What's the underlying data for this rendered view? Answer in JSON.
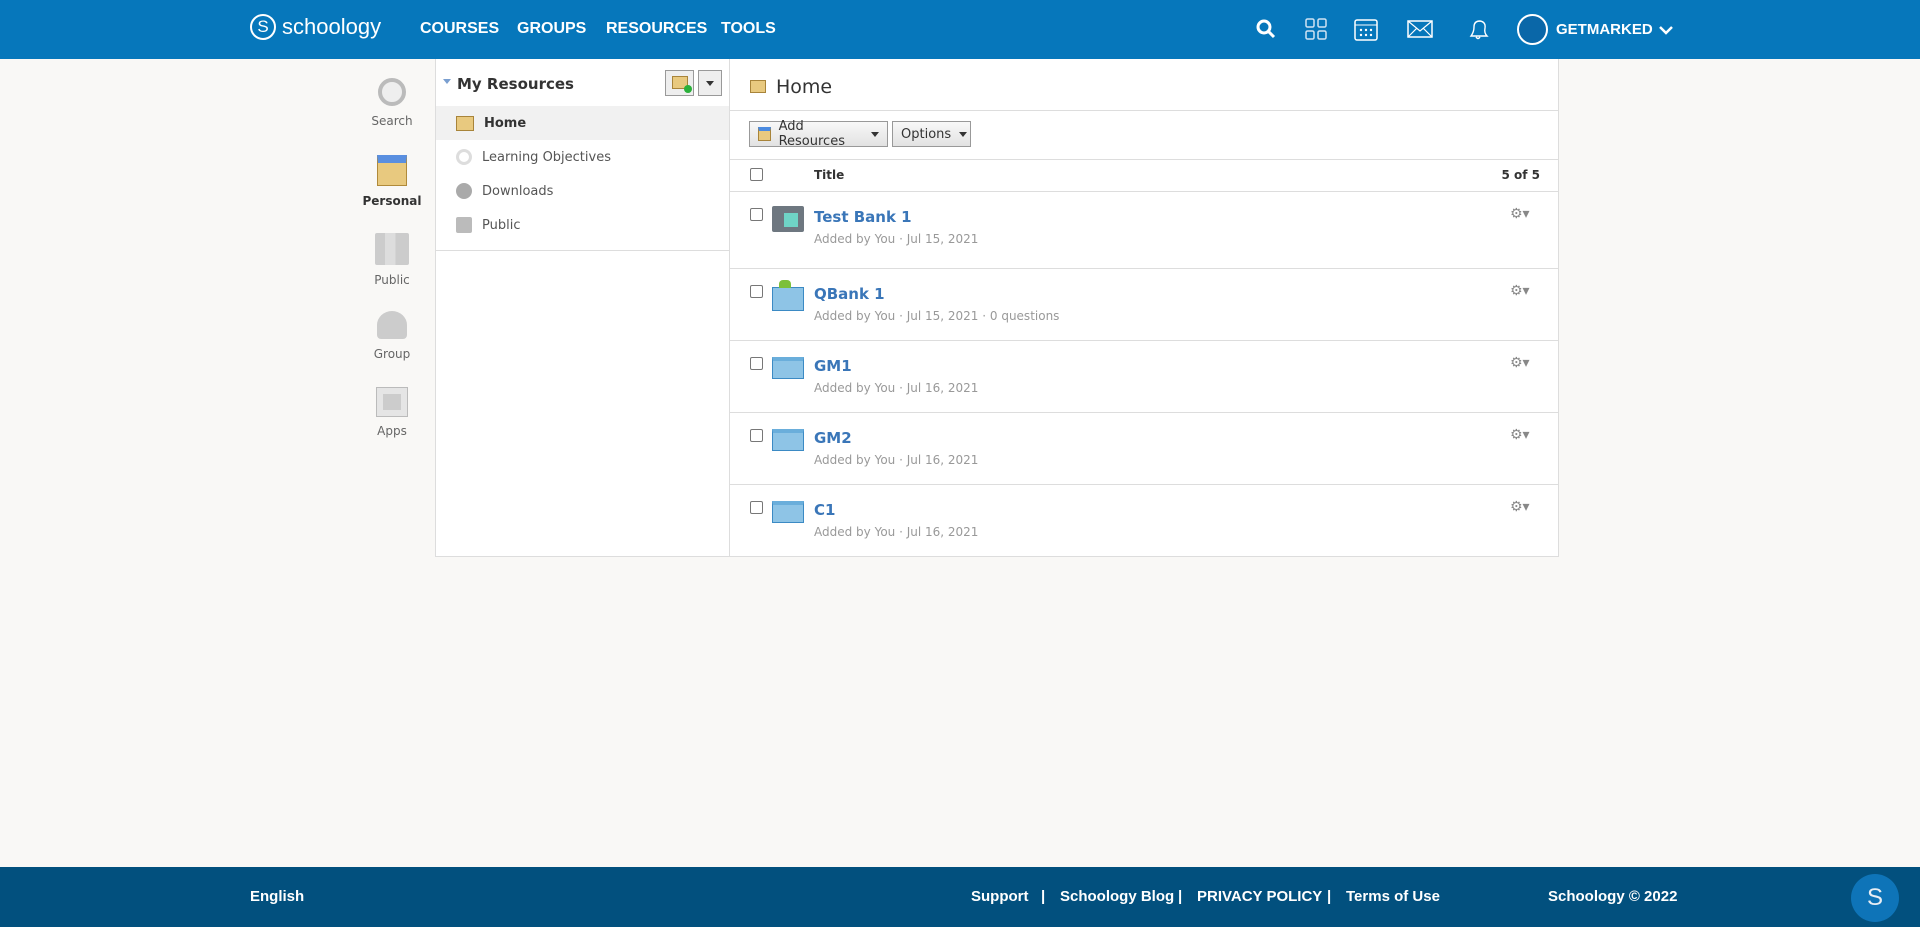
{
  "header": {
    "logo": "schoology",
    "nav": [
      "COURSES",
      "GROUPS",
      "RESOURCES",
      "TOOLS"
    ],
    "user": "GETMARKED"
  },
  "leftnav": [
    "Search",
    "Personal",
    "Public",
    "Group",
    "Apps"
  ],
  "tree": {
    "title": "My Resources",
    "items": [
      "Home",
      "Learning Objectives",
      "Downloads",
      "Public"
    ]
  },
  "main": {
    "title": "Home",
    "add_resources": "Add Resources",
    "options": "Options",
    "col_title": "Title",
    "count": "5 of 5",
    "rows": [
      {
        "title": "Test Bank 1",
        "meta": "Added by You · Jul 15, 2021",
        "icon": "test-bank"
      },
      {
        "title": "QBank 1",
        "meta": "Added by You · Jul 15, 2021 · 0 questions",
        "icon": "question-bank"
      },
      {
        "title": "GM1",
        "meta": "Added by You · Jul 16, 2021",
        "icon": "folder"
      },
      {
        "title": "GM2",
        "meta": "Added by You · Jul 16, 2021",
        "icon": "folder"
      },
      {
        "title": "C1",
        "meta": "Added by You · Jul 16, 2021",
        "icon": "folder"
      }
    ]
  },
  "footer": {
    "language": "English",
    "links": [
      "Support",
      "Schoology Blog",
      "PRIVACY POLICY",
      "Terms of Use"
    ],
    "copyright": "Schoology © 2022",
    "chat": "S"
  },
  "colors": {
    "header": "#0677bb",
    "footer": "#02507e",
    "link": "#3a76b8"
  }
}
